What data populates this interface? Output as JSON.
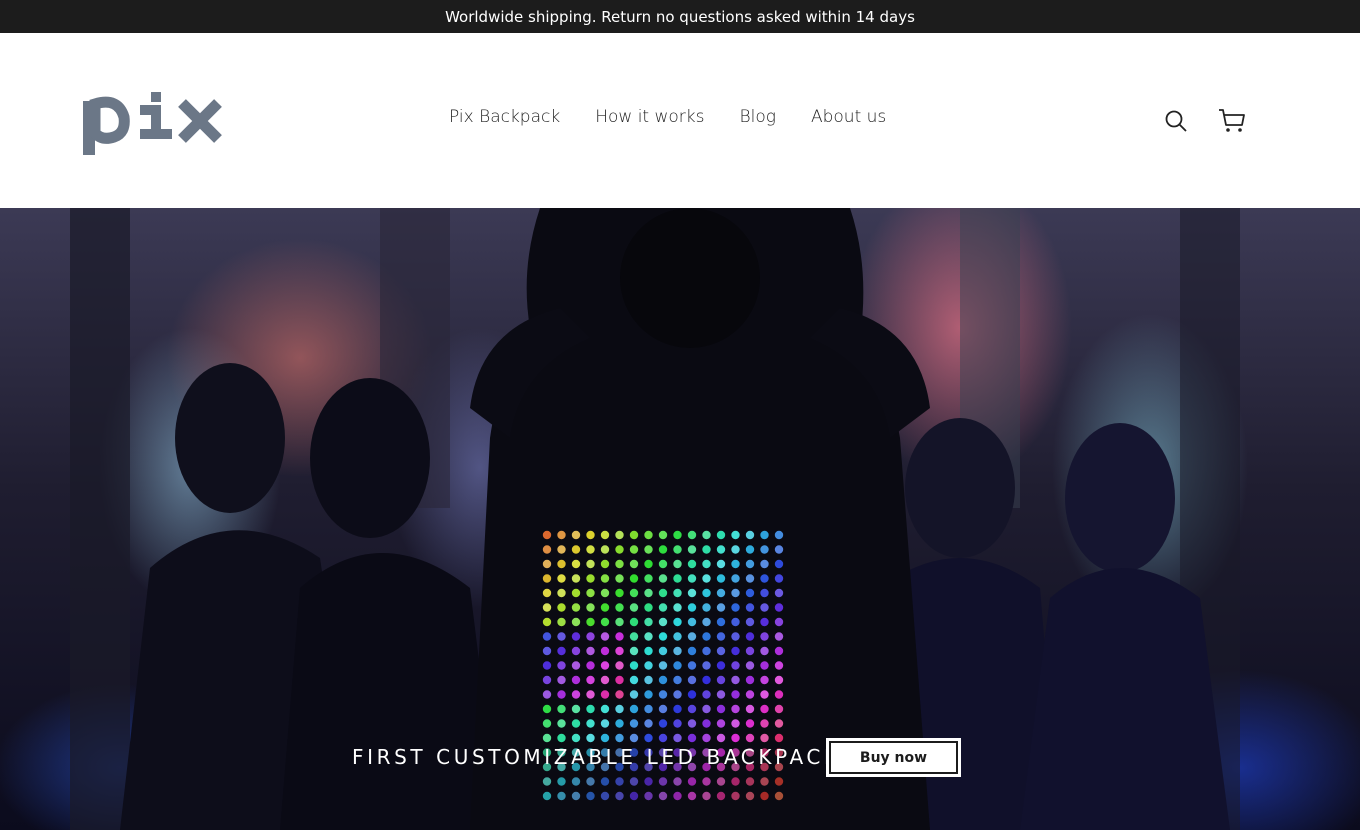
{
  "announcement": {
    "text": "Worldwide shipping. Return no questions asked within 14 days"
  },
  "header": {
    "logo_text": "pix",
    "logo_color": "#6b7787",
    "nav": [
      {
        "label": "Pix Backpack"
      },
      {
        "label": "How it works"
      },
      {
        "label": "Blog"
      },
      {
        "label": "About us"
      }
    ],
    "icons": [
      "search-icon",
      "cart-icon"
    ]
  },
  "hero": {
    "caption": "FIRST CUSTOMIZABLE LED BACKPACK",
    "cta_label": "Buy now"
  }
}
